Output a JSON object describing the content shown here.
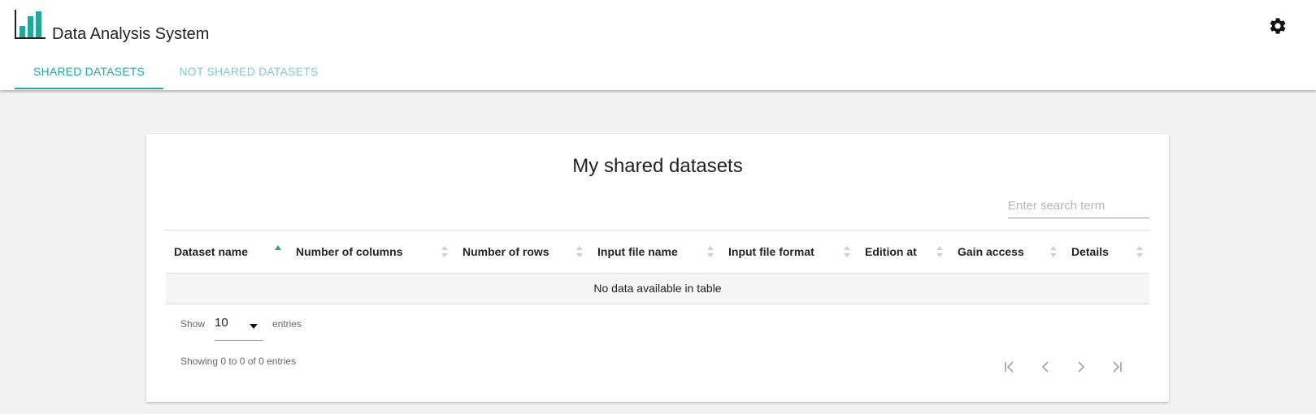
{
  "app": {
    "title": "Data Analysis System",
    "accent_color": "#26a69a",
    "logo_icon": "bar-chart-logo",
    "settings_icon": "gear-icon"
  },
  "tabs": [
    {
      "label": "SHARED DATASETS",
      "active": true
    },
    {
      "label": "NOT SHARED DATASETS",
      "active": false
    }
  ],
  "card": {
    "title": "My shared datasets",
    "search_placeholder": "Enter search term"
  },
  "table": {
    "columns": [
      {
        "label": "Dataset name",
        "sort": "ascending"
      },
      {
        "label": "Number of columns",
        "sort": "none"
      },
      {
        "label": "Number of rows",
        "sort": "none"
      },
      {
        "label": "Input file name",
        "sort": "none"
      },
      {
        "label": "Input file format",
        "sort": "none"
      },
      {
        "label": "Edition at",
        "sort": "none"
      },
      {
        "label": "Gain access",
        "sort": "none"
      },
      {
        "label": "Details",
        "sort": "none"
      }
    ],
    "empty_message": "No data available in table"
  },
  "length": {
    "show_label": "Show",
    "value": "10",
    "entries_label": "entries"
  },
  "info": "Showing 0 to 0 of 0 entries",
  "pagination": {
    "icons": [
      "first-page-icon",
      "previous-page-icon",
      "next-page-icon",
      "last-page-icon"
    ]
  }
}
